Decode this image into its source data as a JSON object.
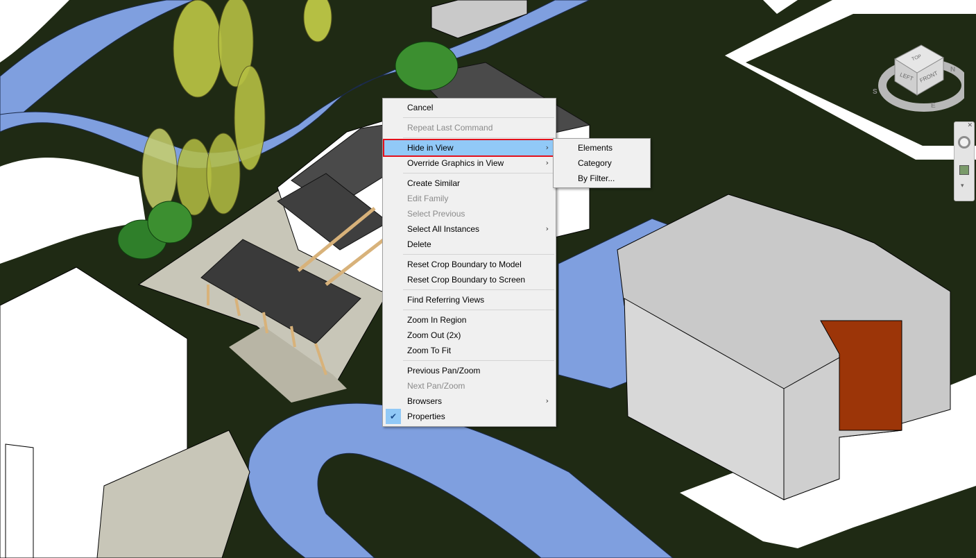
{
  "context_menu": {
    "items": [
      {
        "label": "Cancel",
        "enabled": true
      },
      {
        "label": "Repeat Last Command",
        "enabled": false
      },
      {
        "label": "Hide in View",
        "enabled": true,
        "submenu": true,
        "highlighted": true
      },
      {
        "label": "Override Graphics in View",
        "enabled": true,
        "submenu": true
      },
      {
        "label": "Create Similar",
        "enabled": true
      },
      {
        "label": "Edit Family",
        "enabled": false
      },
      {
        "label": "Select Previous",
        "enabled": false
      },
      {
        "label": "Select All Instances",
        "enabled": true,
        "submenu": true
      },
      {
        "label": "Delete",
        "enabled": true
      },
      {
        "label": "Reset Crop Boundary to Model",
        "enabled": true
      },
      {
        "label": "Reset Crop Boundary to Screen",
        "enabled": true
      },
      {
        "label": "Find Referring Views",
        "enabled": true
      },
      {
        "label": "Zoom In Region",
        "enabled": true
      },
      {
        "label": "Zoom Out (2x)",
        "enabled": true
      },
      {
        "label": "Zoom To Fit",
        "enabled": true
      },
      {
        "label": "Previous Pan/Zoom",
        "enabled": true
      },
      {
        "label": "Next Pan/Zoom",
        "enabled": false
      },
      {
        "label": "Browsers",
        "enabled": true,
        "submenu": true
      },
      {
        "label": "Properties",
        "enabled": true,
        "checked": true
      }
    ]
  },
  "submenu": {
    "items": [
      {
        "label": "Elements"
      },
      {
        "label": "Category"
      },
      {
        "label": "By Filter..."
      }
    ]
  },
  "viewcube": {
    "faces": {
      "top": "TOP",
      "left": "LEFT",
      "front": "FRONT"
    },
    "compass": {
      "north": "N",
      "south": "S",
      "east": "E"
    }
  },
  "colors": {
    "ground": "#1f2a14",
    "road": "#7f9fdf",
    "pavement": "#c8c6b8",
    "building_mass": "#c9c9c9",
    "accent_mass": "#9c3508",
    "tree_light": "#b5bf43",
    "menu_bg": "#f0f0f0",
    "menu_highlight": "#91c9f7",
    "highlight_border": "#e3101c"
  },
  "icons": {
    "submenu_arrow": "chevron-right-icon",
    "check": "checkmark-icon"
  }
}
